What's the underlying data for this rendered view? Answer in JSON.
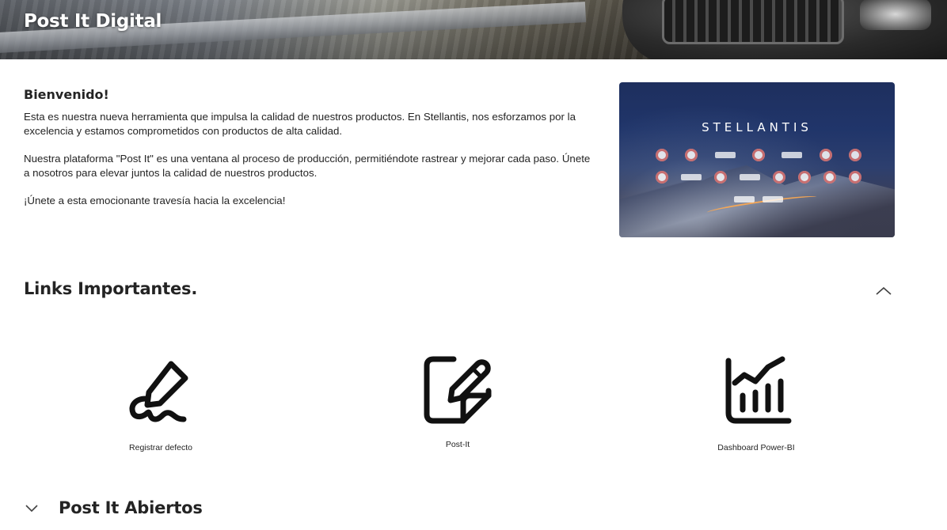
{
  "header": {
    "title": "Post It Digital"
  },
  "welcome": {
    "heading": "Bienvenido!",
    "paragraph1": "Esta es nuestra nueva herramienta que impulsa la calidad de nuestros productos. En Stellantis, nos esforzamos por la excelencia y estamos comprometidos con productos de alta calidad.",
    "paragraph2": "Nuestra plataforma \"Post It\" es una ventana al proceso de producción, permitiéndote rastrear y mejorar cada paso. Únete a nosotros para elevar juntos la calidad de nuestros productos.",
    "paragraph3": "¡Únete a esta emocionante travesía hacia la excelencia!"
  },
  "hero_image": {
    "brand_text": "STELLANTIS"
  },
  "links_section": {
    "title": "Links Importantes.",
    "collapse_icon": "chevron-up-icon",
    "links": [
      {
        "label": "Registrar defecto",
        "icon": "signature-pen-icon"
      },
      {
        "label": "Post-It",
        "icon": "sticky-note-edit-icon"
      },
      {
        "label": "Dashboard Power-BI",
        "icon": "chart-trend-icon"
      }
    ]
  },
  "open_group": {
    "title": "Post It Abiertos",
    "expand_icon": "chevron-down-icon"
  }
}
